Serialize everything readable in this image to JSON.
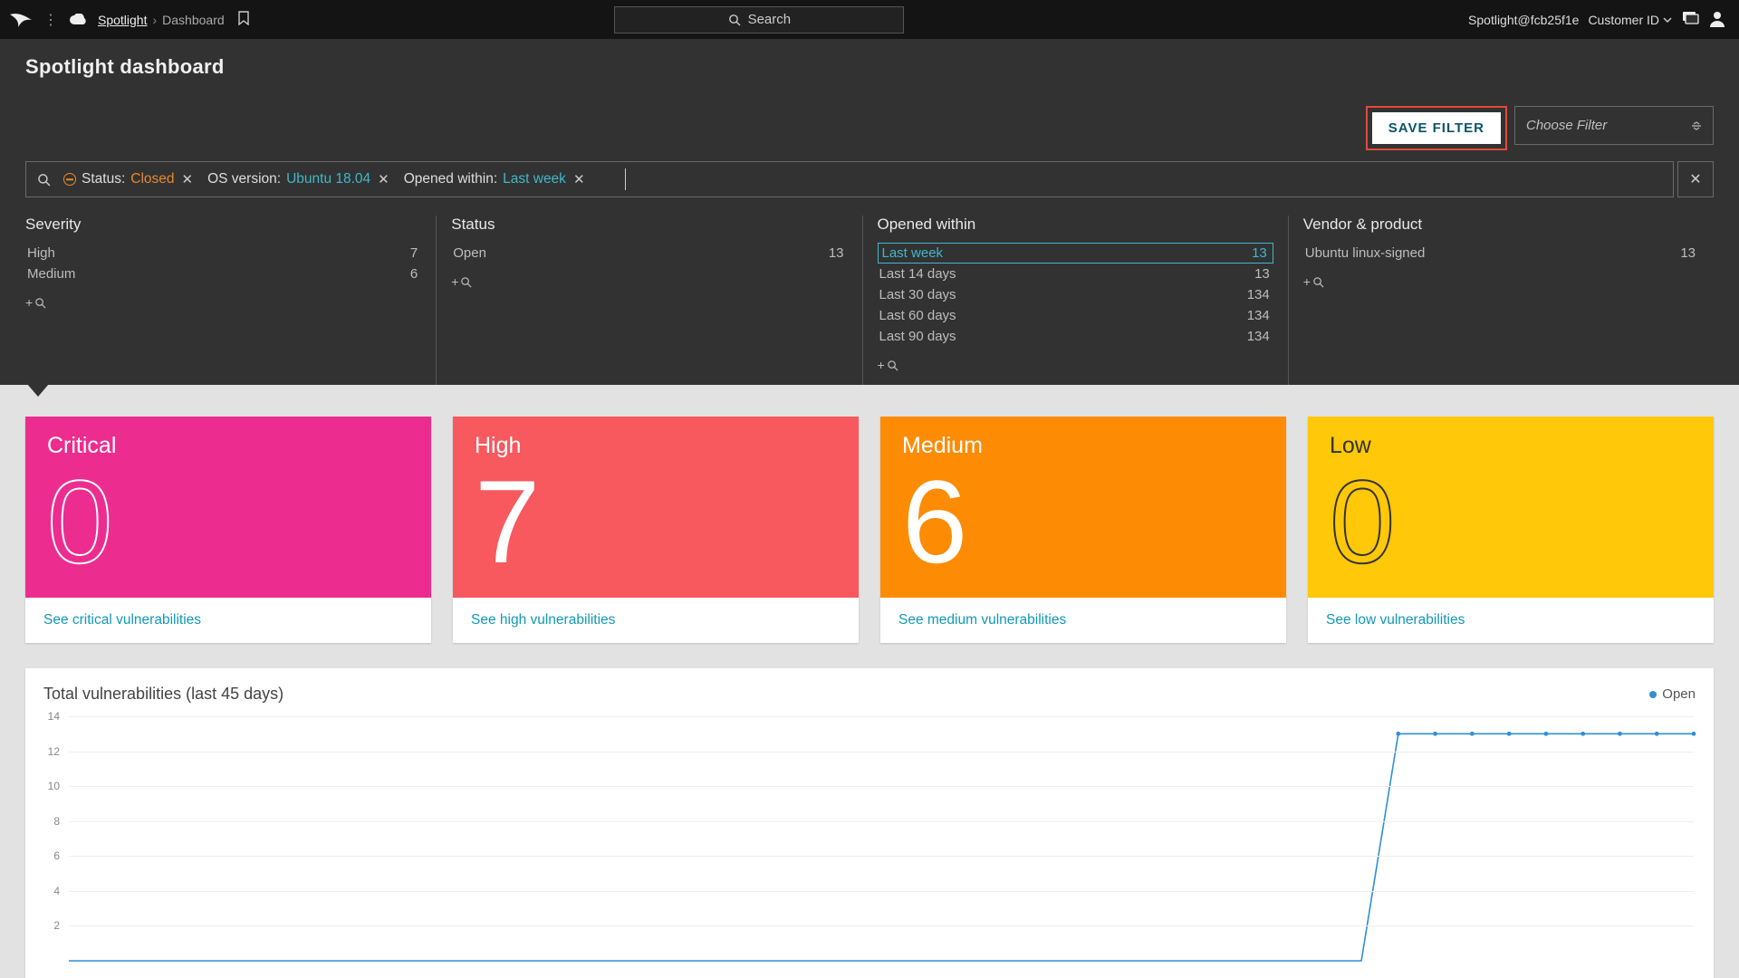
{
  "topbar": {
    "breadcrumb_root": "Spotlight",
    "breadcrumb_current": "Dashboard",
    "search_placeholder": "Search",
    "account": "Spotlight@fcb25f1e",
    "customer_id_label": "Customer ID"
  },
  "page_title": "Spotlight dashboard",
  "actions": {
    "save_filter": "SAVE FILTER",
    "choose_filter_placeholder": "Choose Filter"
  },
  "query_chips": [
    {
      "key": "Status",
      "value": "Closed",
      "style": "orange",
      "negated": true
    },
    {
      "key": "OS version",
      "value": "Ubuntu 18.04",
      "style": "teal",
      "negated": false
    },
    {
      "key": "Opened within",
      "value": "Last week",
      "style": "teal",
      "negated": false
    }
  ],
  "facets": {
    "severity": {
      "title": "Severity",
      "items": [
        {
          "label": "High",
          "count": 7,
          "selected": false
        },
        {
          "label": "Medium",
          "count": 6,
          "selected": false
        }
      ]
    },
    "status": {
      "title": "Status",
      "items": [
        {
          "label": "Open",
          "count": 13,
          "selected": false
        }
      ]
    },
    "opened_within": {
      "title": "Opened within",
      "items": [
        {
          "label": "Last week",
          "count": 13,
          "selected": true
        },
        {
          "label": "Last 14 days",
          "count": 13,
          "selected": false
        },
        {
          "label": "Last 30 days",
          "count": 134,
          "selected": false
        },
        {
          "label": "Last 60 days",
          "count": 134,
          "selected": false
        },
        {
          "label": "Last 90 days",
          "count": 134,
          "selected": false
        }
      ]
    },
    "vendor_product": {
      "title": "Vendor & product",
      "items": [
        {
          "label": "Ubuntu linux-signed",
          "count": 13,
          "selected": false
        }
      ]
    }
  },
  "cards": {
    "critical": {
      "label": "Critical",
      "value": "0",
      "link": "See critical vulnerabilities"
    },
    "high": {
      "label": "High",
      "value": "7",
      "link": "See high vulnerabilities"
    },
    "medium": {
      "label": "Medium",
      "value": "6",
      "link": "See medium vulnerabilities"
    },
    "low": {
      "label": "Low",
      "value": "0",
      "link": "See low vulnerabilities"
    }
  },
  "chart_data": {
    "type": "line",
    "title": "Total vulnerabilities (last 45 days)",
    "ylabel": "",
    "ylim": [
      0,
      14
    ],
    "yticks": [
      2,
      4,
      6,
      8,
      10,
      12,
      14
    ],
    "series": [
      {
        "name": "Open",
        "values": [
          0,
          0,
          0,
          0,
          0,
          0,
          0,
          0,
          0,
          0,
          0,
          0,
          0,
          0,
          0,
          0,
          0,
          0,
          0,
          0,
          0,
          0,
          0,
          0,
          0,
          0,
          0,
          0,
          0,
          0,
          0,
          0,
          0,
          0,
          0,
          0,
          13,
          13,
          13,
          13,
          13,
          13,
          13,
          13,
          13
        ]
      }
    ],
    "legend": "Open",
    "color": "#2f8fd8"
  }
}
